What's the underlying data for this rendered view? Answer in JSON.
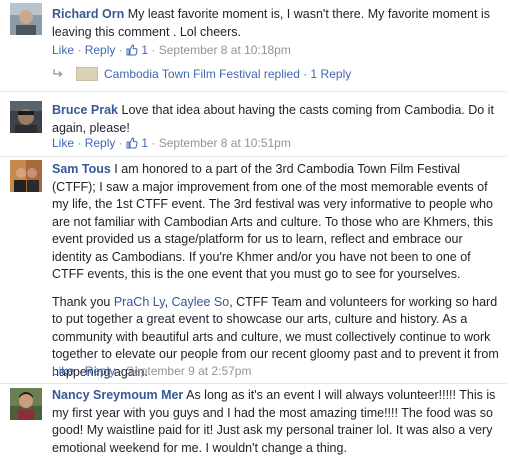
{
  "common": {
    "like": "Like",
    "reply": "Reply",
    "dot": " · "
  },
  "comments": [
    {
      "author": "Richard Orn",
      "text": "My least favorite moment is, I wasn't there. My favorite moment is leaving this comment . Lol cheers.",
      "likes": "1",
      "date": "September 8 at 10:18pm",
      "reply_summary": {
        "page_name": "Cambodia Town Film Festival",
        "replied": "replied",
        "count": "1 Reply"
      }
    },
    {
      "author": "Bruce Prak",
      "text": "Love that idea about having the casts coming from Cambodia. Do it again, please!",
      "likes": "1",
      "date": "September 8 at 10:51pm"
    },
    {
      "author": "Sam Tous",
      "paragraph1": "I am honored to a part of the 3rd Cambodia Town Film Festival (CTFF); I saw a major improvement from one of the most memorable events of my life, the 1st CTFF event. The 3rd festival was very informative to people who are not familiar with Cambodian Arts and culture. To those who are Khmers, this event provided us a stage/platform for us to learn, reflect and embrace our identity as Cambodians. If you're Khmer and/or you have not been to one of CTFF events, this is the one event that you must go to see for yourselves.",
      "paragraph2_prefix": "Thank you ",
      "tag1": "PraCh Ly",
      "tag_sep": ", ",
      "tag2": "Caylee So",
      "paragraph2_suffix": ", CTFF Team and volunteers for working so hard to put together a great event to showcase our arts, culture and history. As a community with beautiful arts and culture, we must collectively continue to work together to elevate our people from our recent gloomy past and to prevent it from happening again.",
      "date": "September 9 at 2:57pm"
    },
    {
      "author": "Nancy Sreymoum Mer",
      "text": "As long as it's an event I will always volunteer!!!!! This is my first year with you guys and I had the most amazing time!!!! The food was so good! My waistline paid for it! Just ask my personal trainer lol. It was also a very emotional weekend for me. I wouldn't change a thing."
    }
  ]
}
